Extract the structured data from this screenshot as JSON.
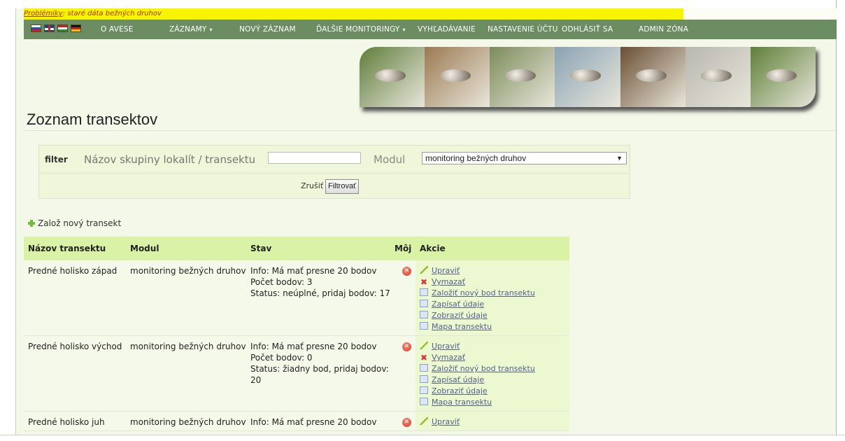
{
  "notice": {
    "link": "Problémiky",
    "text": ": staré dáta bežných druhov"
  },
  "flags": [
    "sk",
    "uk",
    "hu",
    "de"
  ],
  "nav": [
    {
      "label": "O AVESE",
      "caret": false
    },
    {
      "label": "ZÁZNAMY",
      "caret": true
    },
    {
      "label": "NOVÝ ZÁZNAM",
      "caret": false
    },
    {
      "label": "ĎALŠIE MONITORINGY",
      "caret": true
    },
    {
      "label": "VYHĽADÁVANIE",
      "caret": false
    },
    {
      "label": "NASTAVENIE ÚČTU",
      "caret": false
    },
    {
      "label": "ODHLÁSIŤ SA",
      "caret": false
    },
    {
      "label": "ADMIN ZÓNA",
      "caret": false
    }
  ],
  "page_title": "Zoznam transektov",
  "filter": {
    "label": "filter",
    "name_label": "Názov skupiny lokalít / transektu",
    "name_value": "",
    "modul_label": "Modul",
    "modul_selected": "monitoring bežných druhov",
    "cancel_label": "Zrušiť",
    "submit_label": "Filtrovať"
  },
  "add_label": "Založ nový transekt",
  "table": {
    "headers": [
      "Názov transektu",
      "Modul",
      "Stav",
      "Môj",
      "Akcie"
    ],
    "rows": [
      {
        "name": "Predné holisko západ",
        "modul": "monitoring bežných druhov",
        "stav": [
          "Info: Má mať presne 20 bodov",
          "Počet bodov: 3",
          "Status: neúplné, pridaj bodov: 17"
        ],
        "actions": [
          "Upraviť",
          "Vymazať",
          "Založiť nový bod transektu",
          "Zapísať údaje",
          "Zobraziť údaje",
          "Mapa transektu"
        ]
      },
      {
        "name": "Predné holisko východ",
        "modul": "monitoring bežných druhov",
        "stav": [
          "Info: Má mať presne 20 bodov",
          "Počet bodov: 0",
          "Status: žiadny bod, pridaj bodov: 20"
        ],
        "actions": [
          "Upraviť",
          "Vymazať",
          "Založiť nový bod transektu",
          "Zapísať údaje",
          "Zobraziť údaje",
          "Mapa transektu"
        ]
      },
      {
        "name": "Predné holisko juh",
        "modul": "monitoring bežných druhov",
        "stav": [
          "Info: Má mať presne 20 bodov"
        ],
        "actions": [
          "Upraviť"
        ]
      }
    ]
  },
  "action_icons": [
    "pencil-icon",
    "delete-icon",
    "document-icon",
    "document-icon",
    "document-icon",
    "document-icon"
  ],
  "banner_colors": [
    "#5f7d3b",
    "#9c7a52",
    "#7c8c5a",
    "#8aa3b5",
    "#6b4f34",
    "#b8b7b0",
    "#5d7f37"
  ]
}
